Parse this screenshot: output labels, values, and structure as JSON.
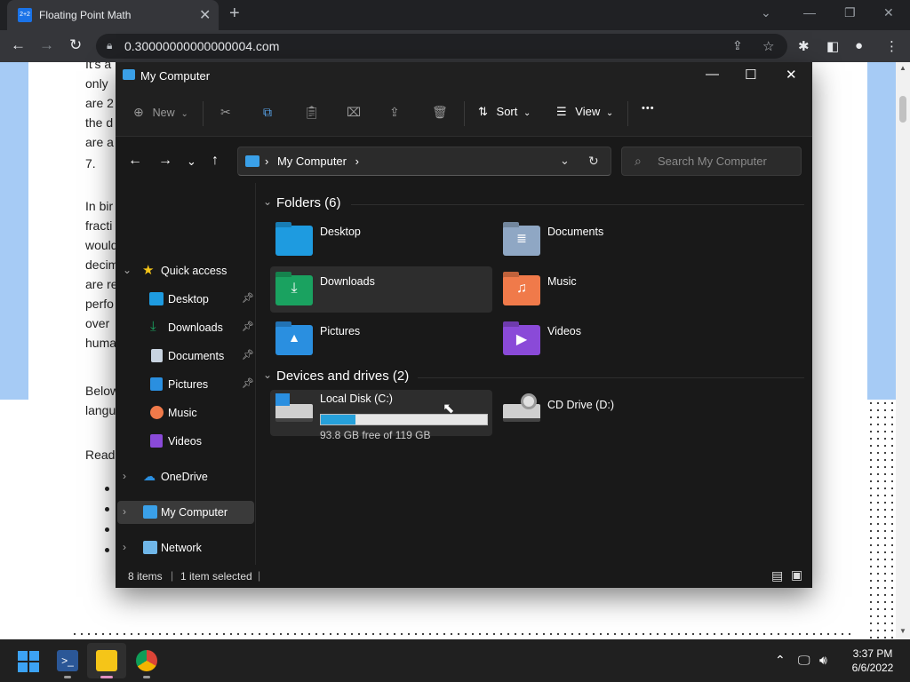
{
  "browser": {
    "tab_title": "Floating Point Math",
    "favicon_text": "2+2",
    "url": "0.30000000000000004.com"
  },
  "page": {
    "lines_top": [
      "It's a",
      "only",
      "are 2",
      "the d",
      "are a",
      "7."
    ],
    "lines_mid": [
      "In bir",
      "fracti",
      "would",
      "decim",
      "are re",
      "perfo",
      "over",
      "huma"
    ],
    "line_below": [
      "Below",
      "langu"
    ],
    "line_read": "Read"
  },
  "explorer": {
    "title": "My Computer",
    "commands": {
      "new": "New",
      "sort": "Sort",
      "view": "View",
      "more": "•••"
    },
    "address": "My Computer",
    "search_placeholder": "Search My Computer",
    "sidebar": {
      "quick_access": "Quick access",
      "items": [
        {
          "label": "Desktop",
          "pinned": true
        },
        {
          "label": "Downloads",
          "pinned": true
        },
        {
          "label": "Documents",
          "pinned": true
        },
        {
          "label": "Pictures",
          "pinned": true
        },
        {
          "label": "Music",
          "pinned": false
        },
        {
          "label": "Videos",
          "pinned": false
        }
      ],
      "onedrive": "OneDrive",
      "my_computer": "My Computer",
      "network": "Network"
    },
    "folders_header": "Folders (6)",
    "folders": [
      "Desktop",
      "Documents",
      "Downloads",
      "Music",
      "Pictures",
      "Videos"
    ],
    "devices_header": "Devices and drives (2)",
    "drive_c": {
      "label": "Local Disk (C:)",
      "free_text": "93.8 GB free of 119 GB",
      "used_fraction": 0.21
    },
    "drive_d": {
      "label": "CD Drive (D:)"
    },
    "status": {
      "items": "8 items",
      "selected": "1 item selected"
    }
  },
  "taskbar": {
    "time": "3:37 PM",
    "date": "6/6/2022"
  },
  "colors": {
    "accent": "#26a0da",
    "folder_blue": "#1e9be0",
    "folder_green": "#1aa260",
    "folder_gray": "#8fa7c4",
    "folder_orange": "#f07a4a",
    "folder_sky": "#2a8fe0",
    "folder_purple": "#8a4ad8"
  }
}
